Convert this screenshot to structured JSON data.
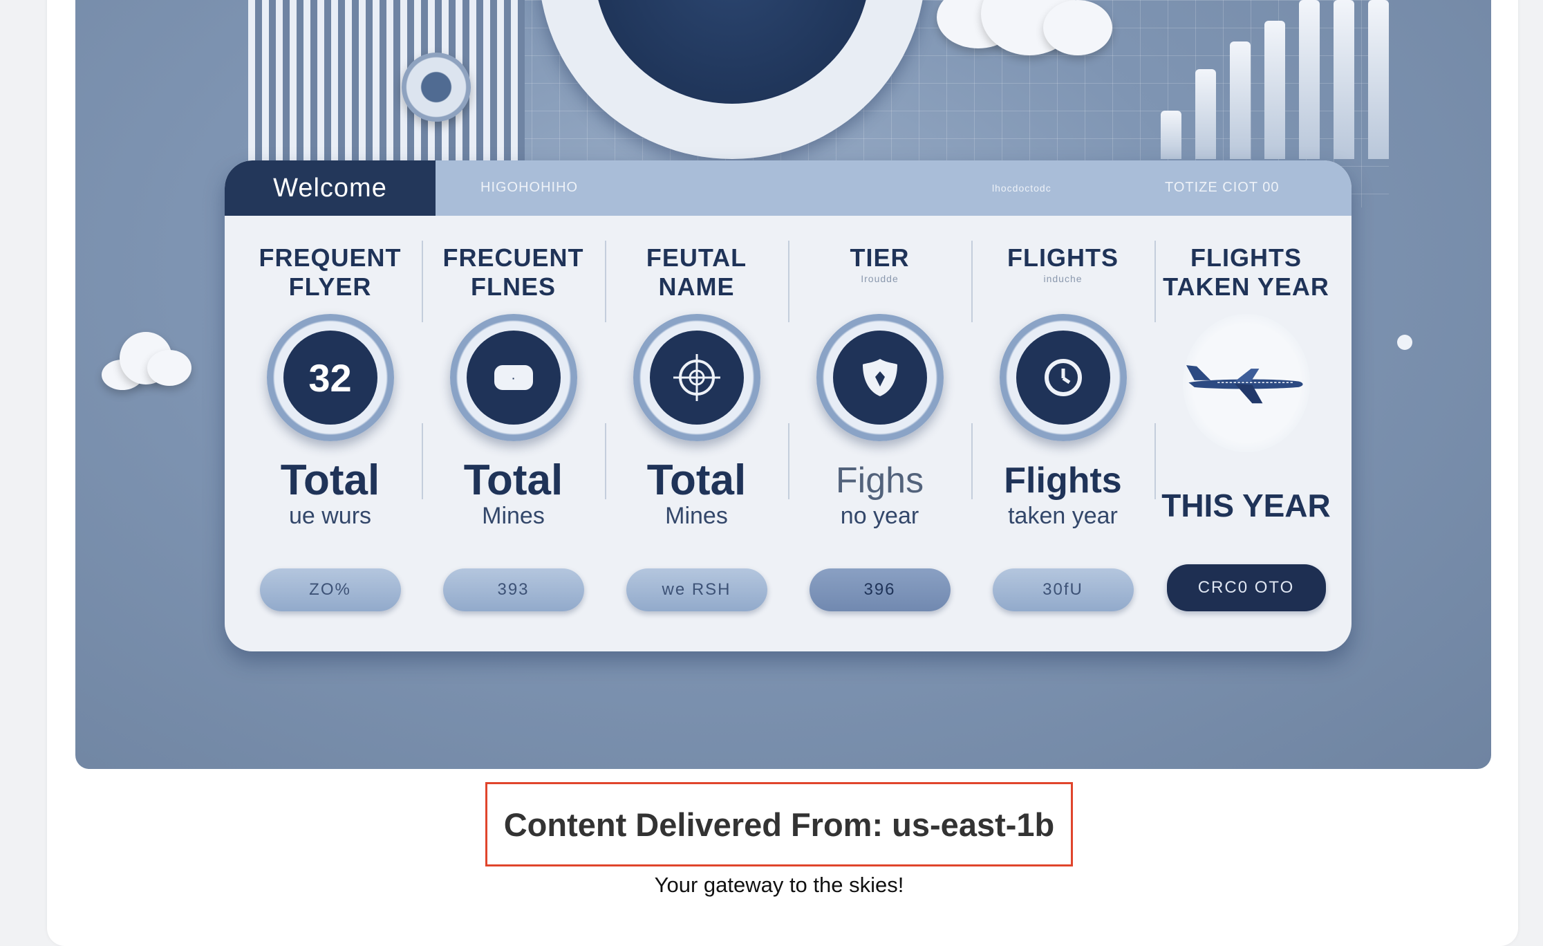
{
  "hero": {
    "panel": {
      "welcome_tab": "Welcome",
      "header_left": "HIGOHOHIHO",
      "header_right_a": "lhocdoctodc",
      "header_right_b": "TOTIZE CIOT 00",
      "columns": [
        {
          "title": "FREQUENT\nFLYER",
          "subtitle": "",
          "badge": "32",
          "big": "Total",
          "sub": "ue wurs",
          "pill": "ZO%"
        },
        {
          "title": "FRECUENT\nFLNES",
          "subtitle": "",
          "badge": "",
          "big": "Total",
          "sub": "Mines",
          "pill": "393"
        },
        {
          "title": "FEUTAL\nNAME",
          "subtitle": "",
          "badge": "",
          "big": "Total",
          "sub": "Mines",
          "pill": "we RSH"
        },
        {
          "title": "TIER",
          "subtitle": "Iroudde",
          "badge": "",
          "big": "Fighs",
          "sub": "no year",
          "pill": "396"
        },
        {
          "title": "FLIGHTS",
          "subtitle": "induche",
          "badge": "",
          "big": "Flights",
          "sub": "taken year",
          "pill": "30fU"
        },
        {
          "title": "FLIGHTS\nTAKEN YEAR",
          "subtitle": "",
          "badge": "",
          "big": "THIS YEAR",
          "sub": "",
          "pill": "CRC0 OTO"
        }
      ]
    }
  },
  "footer": {
    "region_text": "Content Delivered From: us-east-1b",
    "tagline": "Your gateway to the skies!"
  },
  "colors": {
    "navy": "#1f3358",
    "highlight_border": "#e0452c"
  },
  "icons": [
    "speedometer-dial-icon",
    "chat-bubble-icon",
    "target-icon",
    "shield-icon",
    "clock-icon",
    "airplane-icon",
    "cloud-icon"
  ]
}
